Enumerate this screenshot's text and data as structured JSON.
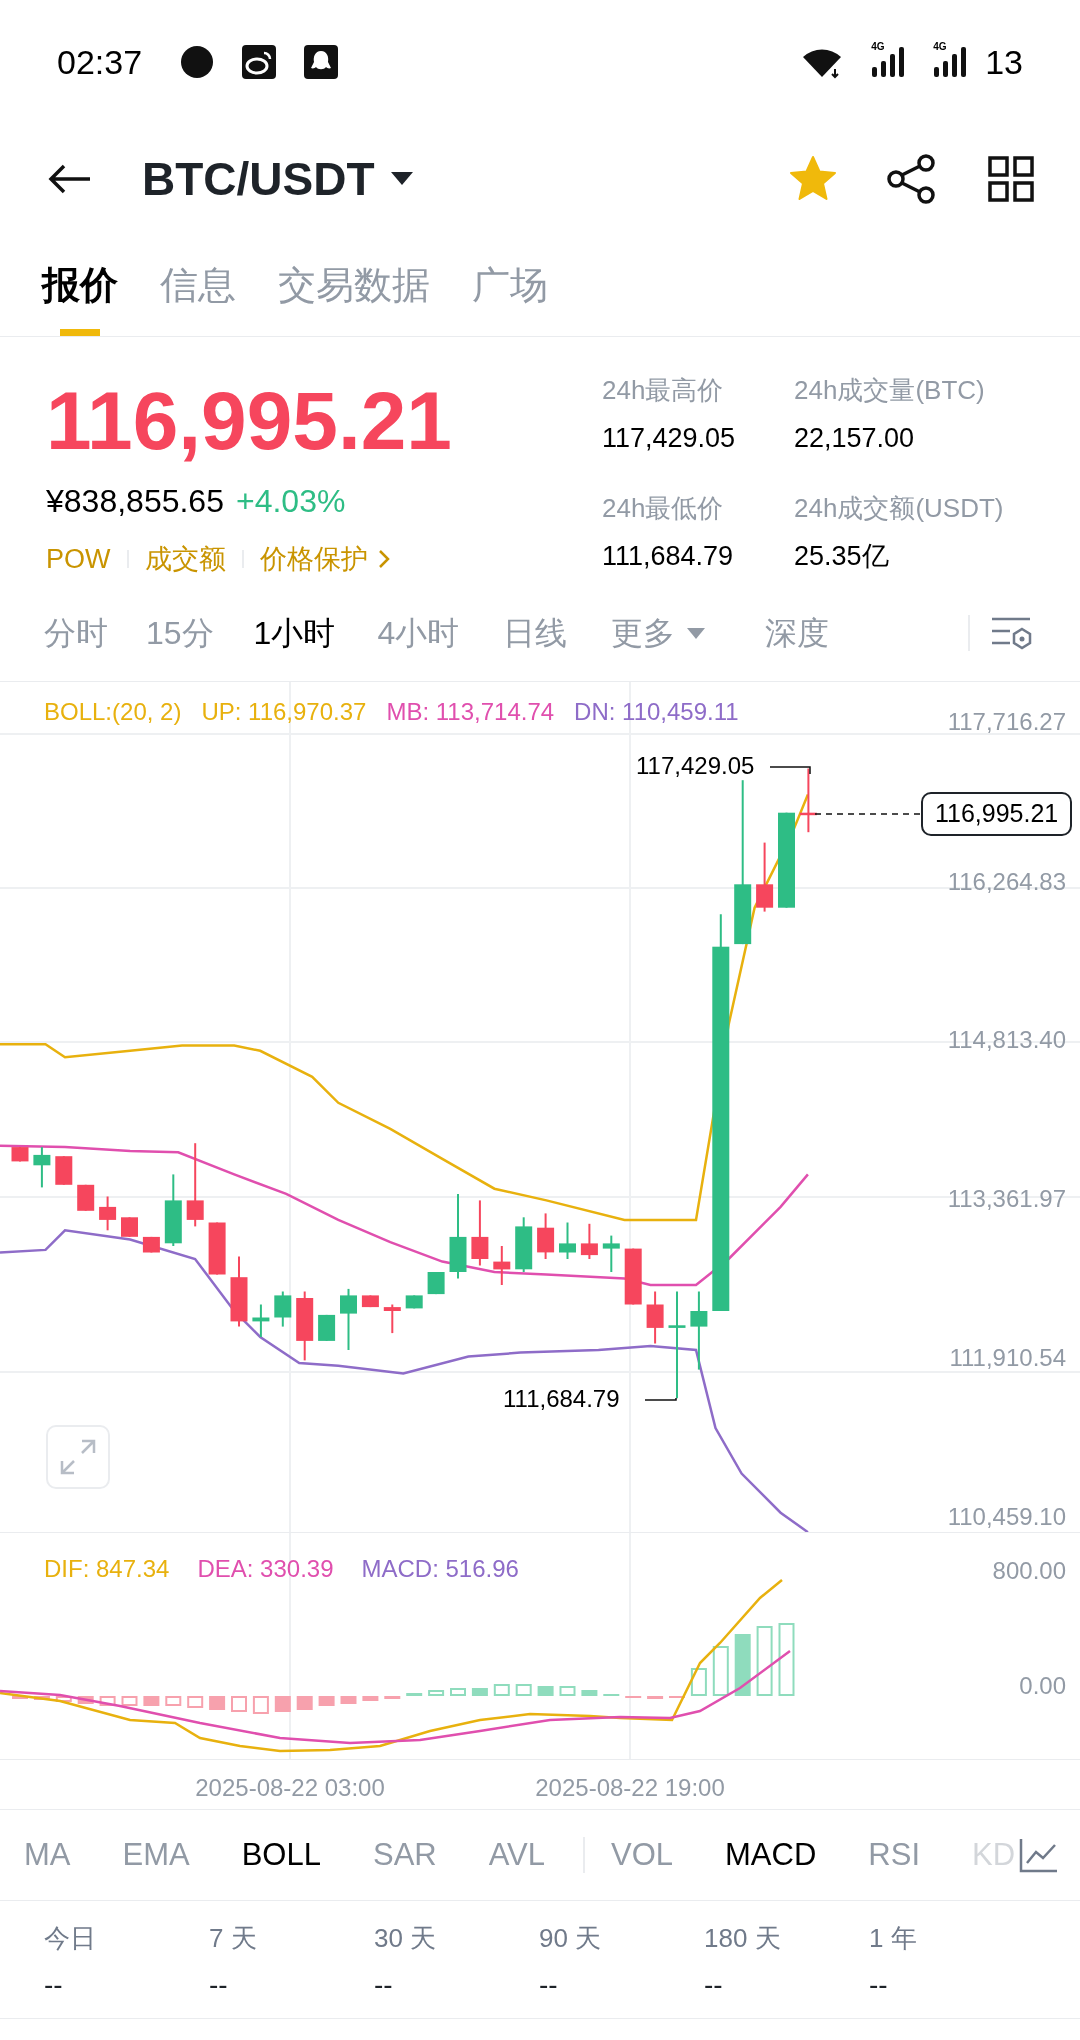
{
  "status_bar": {
    "time": "02:37",
    "networks": [
      "4G",
      "4G"
    ],
    "battery": "13"
  },
  "header": {
    "title": "BTC/USDT",
    "favorite": true
  },
  "tabs": [
    {
      "label": "报价",
      "selected": true
    },
    {
      "label": "信息",
      "selected": false
    },
    {
      "label": "交易数据",
      "selected": false
    },
    {
      "label": "广场",
      "selected": false
    }
  ],
  "ticker": {
    "price": "116,995.21",
    "fiat": "¥838,855.65",
    "change": "+4.03%",
    "tags": [
      "POW",
      "成交额",
      "价格保护"
    ]
  },
  "stats": [
    {
      "label": "24h最高价",
      "value": "117,429.05"
    },
    {
      "label": "24h成交量(BTC)",
      "value": "22,157.00"
    },
    {
      "label": "24h最低价",
      "value": "111,684.79"
    },
    {
      "label": "24h成交额(USDT)",
      "value": "25.35亿"
    }
  ],
  "intervals": [
    {
      "label": "分时",
      "selected": false,
      "kind": "interval"
    },
    {
      "label": "15分",
      "selected": false,
      "kind": "interval"
    },
    {
      "label": "1小时",
      "selected": true,
      "kind": "interval"
    },
    {
      "label": "4小时",
      "selected": false,
      "kind": "interval"
    },
    {
      "label": "日线",
      "selected": false,
      "kind": "interval"
    },
    {
      "label": "更多",
      "selected": false,
      "kind": "dropdown"
    },
    {
      "label": "深度",
      "selected": false,
      "kind": "interval"
    }
  ],
  "boll_legend": [
    {
      "text": "BOLL:(20, 2)",
      "color": "#e8b10e"
    },
    {
      "text": "UP: 116,970.37",
      "color": "#e8b10e"
    },
    {
      "text": "MB: 113,714.74",
      "color": "#e04fae"
    },
    {
      "text": "DN: 110,459.11",
      "color": "#8e6cc8"
    }
  ],
  "price_axis": [
    "117,716.27",
    "116,264.83",
    "114,813.40",
    "113,361.97",
    "111,910.54",
    "110,459.10"
  ],
  "high_marker": "117,429.05",
  "low_marker": "111,684.79",
  "last_price": "116,995.21",
  "macd_legend": [
    {
      "text": "DIF: 847.34",
      "color": "#e8b10e"
    },
    {
      "text": "DEA: 330.39",
      "color": "#e04fae"
    },
    {
      "text": "MACD: 516.96",
      "color": "#8e6cc8"
    }
  ],
  "macd_axis": [
    "800.00",
    "0.00"
  ],
  "time_axis": [
    "2025-08-22 03:00",
    "2025-08-22 19:00"
  ],
  "indicator_groups": [
    [
      {
        "label": "MA",
        "selected": false
      },
      {
        "label": "EMA",
        "selected": false
      },
      {
        "label": "BOLL",
        "selected": true
      },
      {
        "label": "SAR",
        "selected": false
      },
      {
        "label": "AVL",
        "selected": false
      }
    ],
    [
      {
        "label": "VOL",
        "selected": false
      },
      {
        "label": "MACD",
        "selected": true
      },
      {
        "label": "RSI",
        "selected": false
      },
      {
        "label": "KD",
        "selected": false
      }
    ]
  ],
  "returns": [
    {
      "period": "今日",
      "value": "--"
    },
    {
      "period": "7 天",
      "value": "--"
    },
    {
      "period": "30 天",
      "value": "--"
    },
    {
      "period": "90 天",
      "value": "--"
    },
    {
      "period": "180 天",
      "value": "--"
    },
    {
      "period": "1 年",
      "value": "--"
    }
  ]
}
